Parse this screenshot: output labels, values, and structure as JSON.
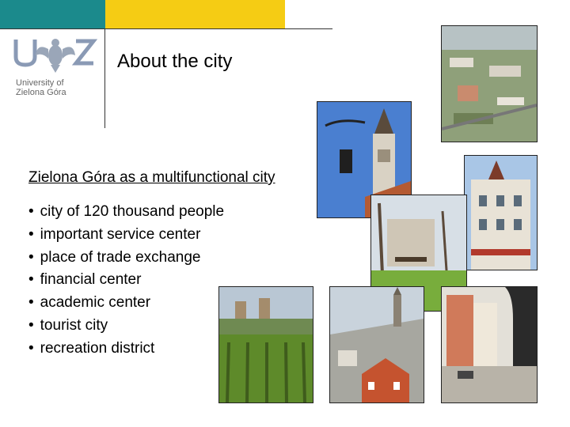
{
  "logo": {
    "line1": "University of",
    "line2": "Zielona Góra",
    "monogram": "UZ",
    "emblem": "eagle-crest-icon"
  },
  "slide": {
    "title": "About the city",
    "subtitle": "Zielona Góra as a multifunctional city",
    "bullets": [
      "city of 120 thousand people",
      "important service center",
      "place of trade exchange",
      "financial center",
      "academic center",
      "tourist city",
      "recreation district"
    ]
  },
  "colors": {
    "teal": "#1b8a8c",
    "yellow": "#f5cc14"
  }
}
